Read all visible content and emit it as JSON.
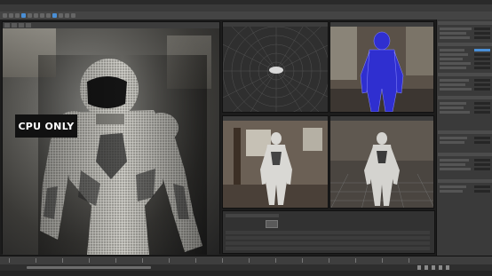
{
  "overlay": {
    "label": "CPU ONLY"
  },
  "colors": {
    "accent": "#4a8fd6",
    "wireframe": "#3a3adf",
    "background": "#1c1c1c",
    "panel": "#3a3a3a"
  },
  "icons": [
    "render-settings-icon",
    "snapshot-icon",
    "play-icon",
    "stop-icon"
  ]
}
